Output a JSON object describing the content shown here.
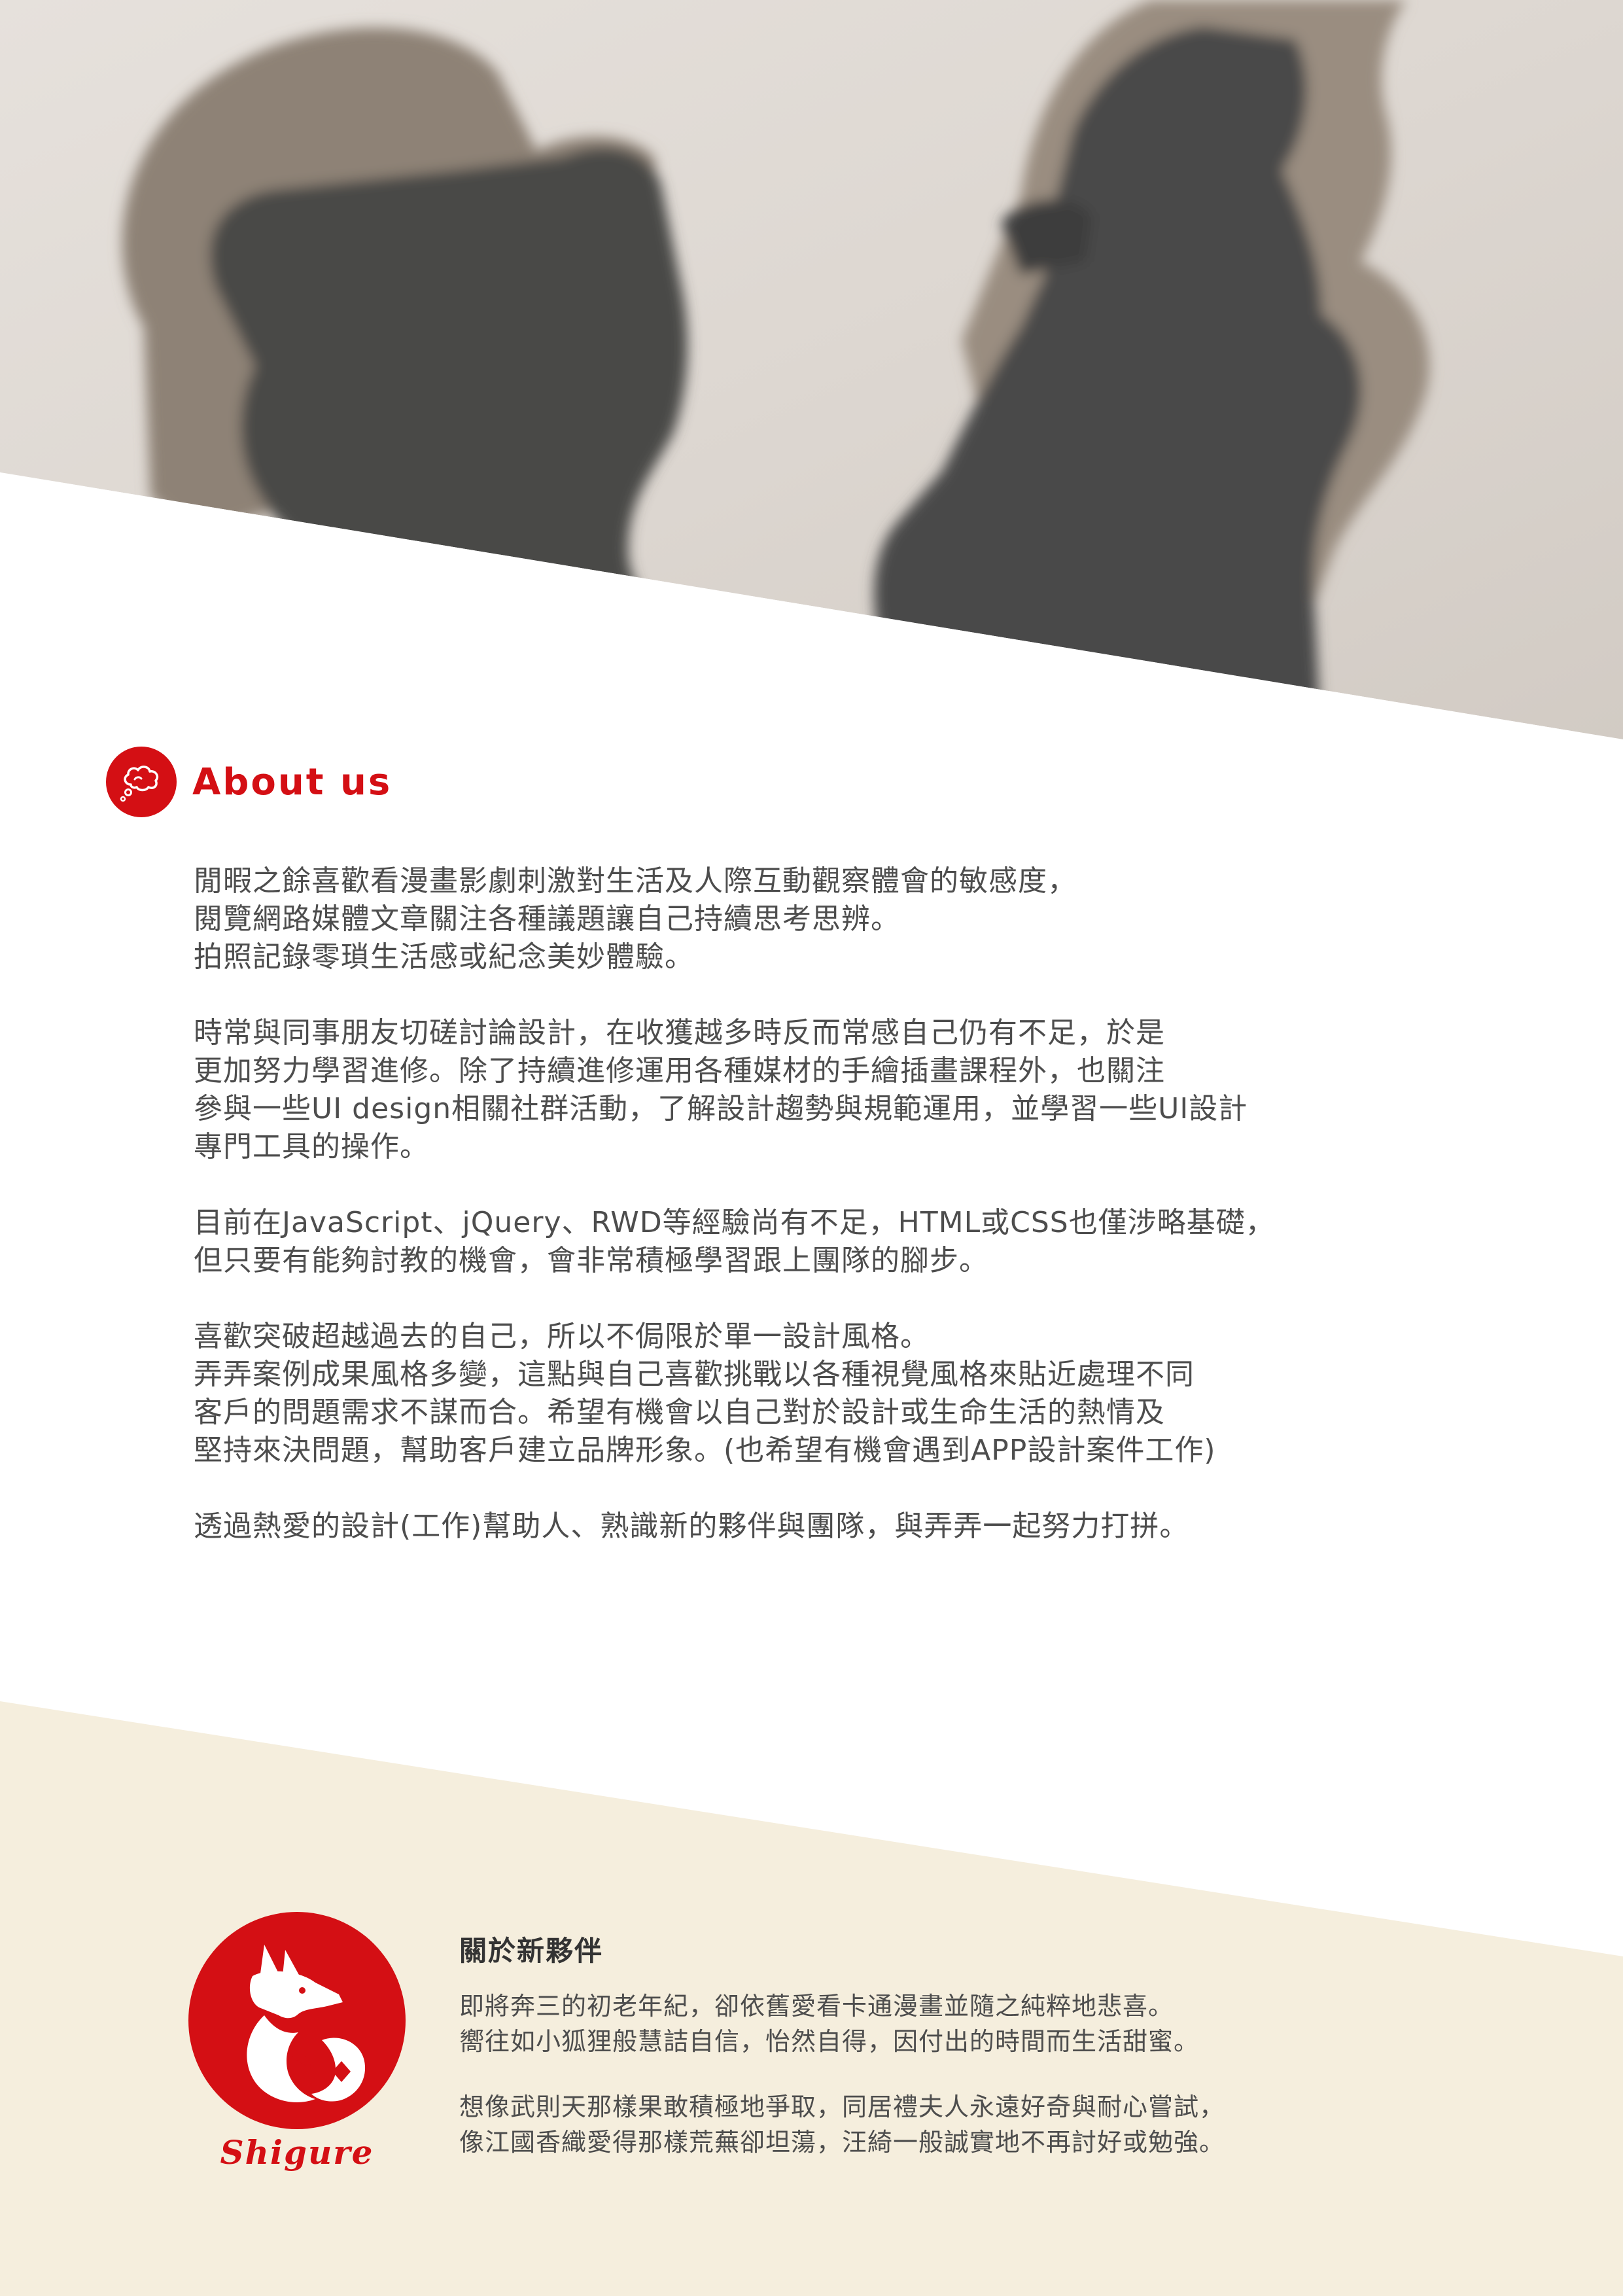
{
  "colors": {
    "accent": "#d40f14",
    "text": "#4d4d4d",
    "beige": "#f5eedd",
    "photo_bg": "#ddd8d3"
  },
  "hero": {
    "image": "shadow-silhouettes-photo"
  },
  "about": {
    "icon": "thought-cloud-icon",
    "title": "About us",
    "paragraphs": [
      {
        "lines": [
          "閒暇之餘喜歡看漫畫影劇刺激對生活及人際互動觀察體會的敏感度，",
          "閱覽網路媒體文章關注各種議題讓自己持續思考思辨。",
          "拍照記錄零瑣生活感或紀念美妙體驗。"
        ]
      },
      {
        "lines": [
          "時常與同事朋友切磋討論設計，在收獲越多時反而常感自己仍有不足，於是",
          "更加努力學習進修。除了持續進修運用各種媒材的手繪插畫課程外，也關注",
          "參與一些UI design相關社群活動，了解設計趨勢與規範運用，並學習一些UI設計",
          "專門工具的操作。"
        ]
      },
      {
        "lines": [
          "目前在JavaScript、jQuery、RWD等經驗尚有不足，HTML或CSS也僅涉略基礎，",
          "但只要有能夠討教的機會，會非常積極學習跟上團隊的腳步。"
        ]
      },
      {
        "lines": [
          "喜歡突破超越過去的自己，所以不侷限於單一設計風格。",
          "弄弄案例成果風格多變，這點與自己喜歡挑戰以各種視覺風格來貼近處理不同",
          "客戶的問題需求不謀而合。希望有機會以自己對於設計或生命生活的熱情及",
          "堅持來決問題，幫助客戶建立品牌形象。(也希望有機會遇到APP設計案件工作)"
        ]
      },
      {
        "lines": [
          "透過熱愛的設計(工作)幫助人、熟識新的夥伴與團隊，與弄弄一起努力打拼。"
        ]
      }
    ]
  },
  "partner": {
    "logo_icon": "fox-icon",
    "logo_name": "Shigure",
    "title": "關於新夥伴",
    "paragraphs": [
      {
        "lines": [
          "即將奔三的初老年紀，卻依舊愛看卡通漫畫並隨之純粹地悲喜。",
          "嚮往如小狐狸般慧詰自信，怡然自得，因付出的時間而生活甜蜜。"
        ]
      },
      {
        "lines": [
          "想像武則天那樣果敢積極地爭取，同居禮夫人永遠好奇與耐心嘗試，",
          "像江國香織愛得那樣荒蕪卻坦蕩，汪綺一般誠實地不再討好或勉強。"
        ]
      }
    ]
  }
}
